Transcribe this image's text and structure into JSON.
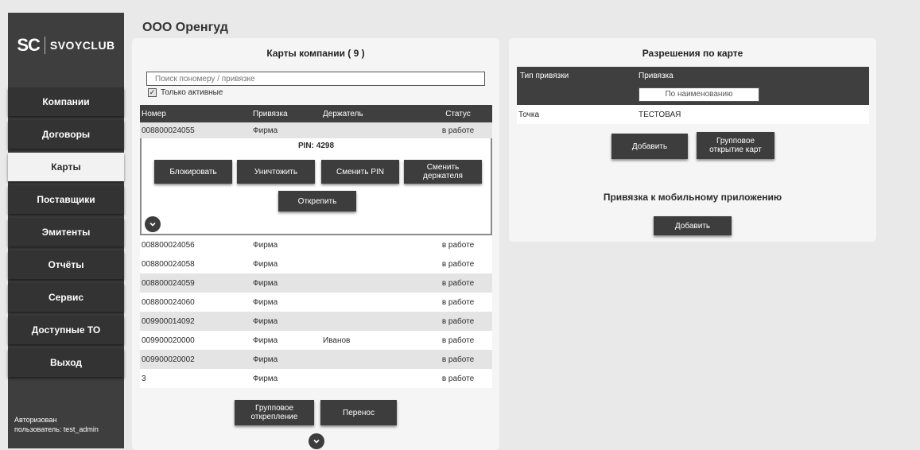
{
  "sidebar": {
    "logo_mark": "SC",
    "logo_text": "SVOYCLUB",
    "items": [
      {
        "label": "Компании"
      },
      {
        "label": "Договоры"
      },
      {
        "label": "Карты"
      },
      {
        "label": "Поставщики"
      },
      {
        "label": "Эмитенты"
      },
      {
        "label": "Отчёты"
      },
      {
        "label": "Сервис"
      },
      {
        "label": "Доступные ТО"
      },
      {
        "label": "Выход"
      }
    ],
    "active_item": "Карты",
    "auth_line1": "Авторизован",
    "auth_line2": "пользователь: test_admin"
  },
  "header": {
    "org_name": "ООО Оренгуд"
  },
  "cards_panel": {
    "title": "Карты компании ( 9 )",
    "search_placeholder": "Поиск пономеру / привязке",
    "only_active_label": "Только активные",
    "only_active_checked": true,
    "columns": [
      "Номер",
      "Привязка",
      "Держатель",
      "Статус"
    ],
    "expanded_row": {
      "number": "008800024055",
      "binding": "Фирма",
      "holder": "",
      "status": "в работе"
    },
    "pin_text": "PIN: 4298",
    "actions": {
      "block": "Блокировать",
      "destroy": "Уничтожить",
      "change_pin": "Сменить PIN",
      "change_holder_1": "Сменить",
      "change_holder_2": "держателя",
      "detach": "Открепить"
    },
    "rows": [
      {
        "number": "008800024056",
        "binding": "Фирма",
        "holder": "",
        "status": "в работе"
      },
      {
        "number": "008800024058",
        "binding": "Фирма",
        "holder": "",
        "status": "в работе"
      },
      {
        "number": "008800024059",
        "binding": "Фирма",
        "holder": "",
        "status": "в работе"
      },
      {
        "number": "008800024060",
        "binding": "Фирма",
        "holder": "",
        "status": "в работе"
      },
      {
        "number": "009900014092",
        "binding": "Фирма",
        "holder": "",
        "status": "в работе"
      },
      {
        "number": "009900020000",
        "binding": "Фирма",
        "holder": "Иванов",
        "status": "в работе"
      },
      {
        "number": "009900020002",
        "binding": "Фирма",
        "holder": "",
        "status": "в работе"
      },
      {
        "number": "3",
        "binding": "Фирма",
        "holder": "",
        "status": "в работе"
      }
    ],
    "group_detach_1": "Групповое",
    "group_detach_2": "открепление",
    "transfer": "Перенос"
  },
  "permissions_panel": {
    "title": "Разрешения по карте",
    "columns": [
      "Тип привязки",
      "Привязка"
    ],
    "filter_placeholder": "По наименованию",
    "rows": [
      {
        "type": "Точка",
        "binding": "ТЕСТОВАЯ"
      }
    ],
    "add_label": "Добавить",
    "group_open_1": "Групповое",
    "group_open_2": "открытие карт",
    "mobile_title": "Привязка к мобильному приложению",
    "mobile_add_label": "Добавить"
  },
  "icons": {
    "expand": "chevron-down-icon",
    "checkbox": "check-icon"
  },
  "colors": {
    "dark": "#3d3d3d",
    "background": "#e9e9e9",
    "panel": "#f5f5f5",
    "row_alt": "#e4e4e4"
  }
}
